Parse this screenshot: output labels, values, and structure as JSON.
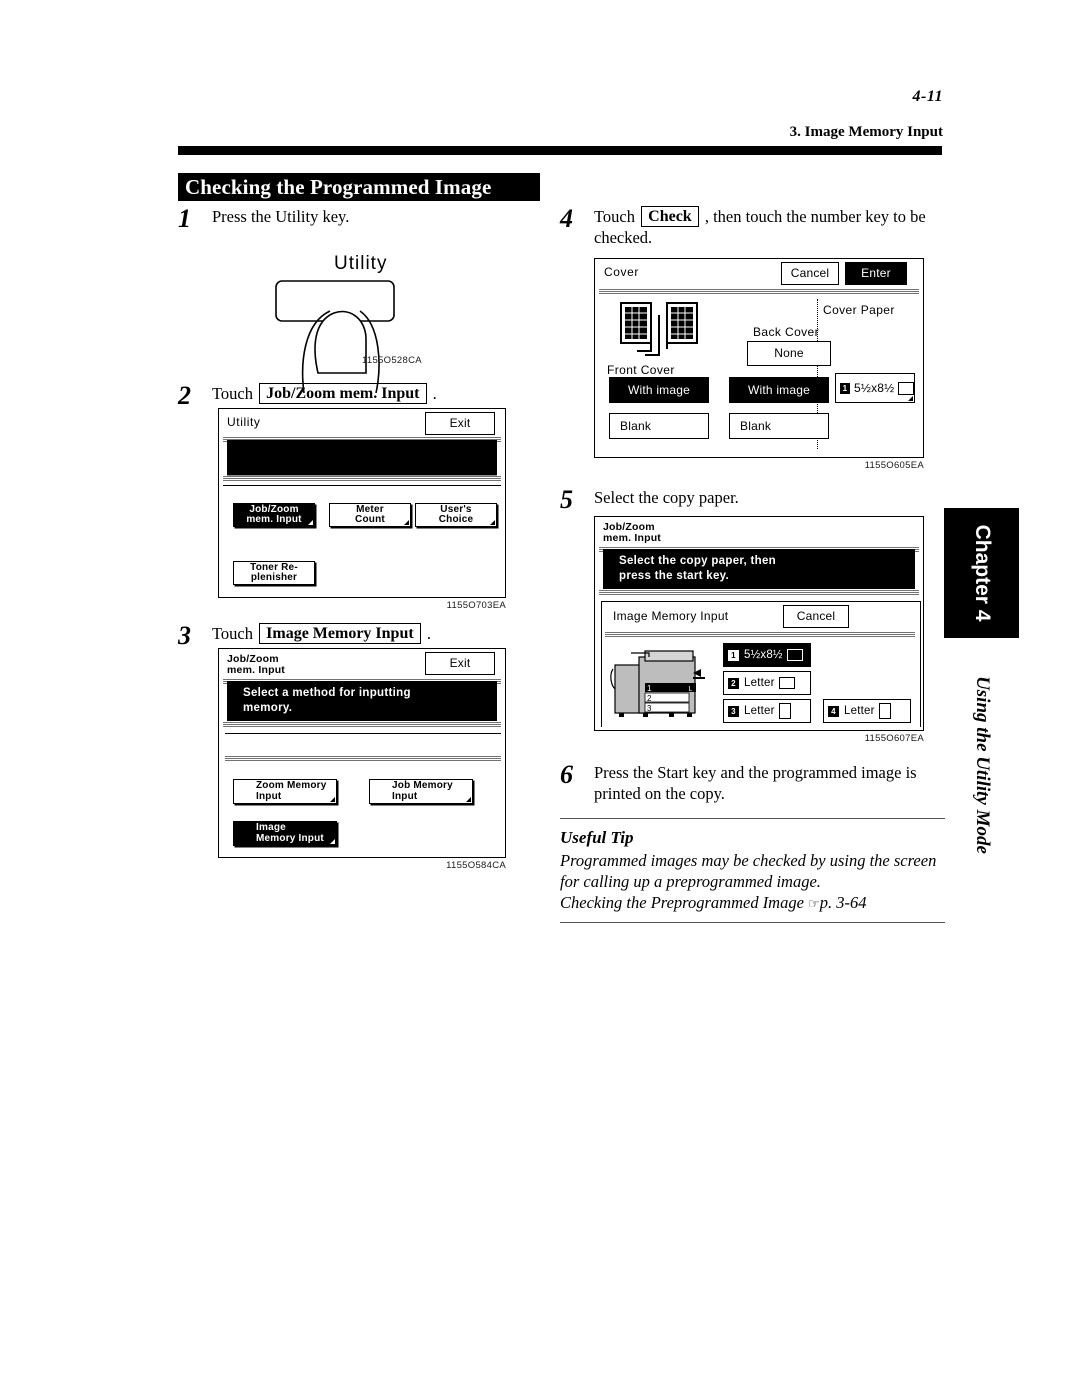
{
  "page": {
    "number": "4-11",
    "running_head": "3. Image Memory Input",
    "section_title": "Checking the Programmed Image"
  },
  "chapter_tab": {
    "label": "Chapter 4",
    "subtitle": "Using the Utility Mode"
  },
  "steps": {
    "s1": {
      "num": "1",
      "text": "Press the Utility key."
    },
    "s2": {
      "num": "2",
      "pre": "Touch",
      "key": "Job/Zoom mem. Input",
      "post": "."
    },
    "s3": {
      "num": "3",
      "pre": "Touch",
      "key": "Image Memory Input",
      "post": "."
    },
    "s4": {
      "num": "4",
      "pre": "Touch",
      "key": "Check",
      "post": ", then touch the number key to be checked."
    },
    "s5": {
      "num": "5",
      "text": "Select the copy paper."
    },
    "s6": {
      "num": "6",
      "text": "Press the Start key and the programmed image is printed on the copy."
    }
  },
  "fig1": {
    "label": "Utility",
    "id": "1155O528CA"
  },
  "fig2": {
    "id": "1155O703EA",
    "title": "Utility",
    "exit": "Exit",
    "buttons": [
      {
        "label": "Job/Zoom\nmem. Input",
        "selected": true
      },
      {
        "label": "Meter\nCount",
        "selected": false
      },
      {
        "label": "User's\nChoice",
        "selected": false
      },
      {
        "label": "Toner Re-\nplenisher",
        "selected": false
      }
    ]
  },
  "fig3": {
    "id": "1155O584CA",
    "title": "Job/Zoom\nmem. Input",
    "exit": "Exit",
    "message": "Select a method for inputting\nmemory.",
    "buttons": [
      {
        "label": "Zoom Memory\nInput",
        "selected": false
      },
      {
        "label": "Job Memory\nInput",
        "selected": false
      },
      {
        "label": "Image\nMemory Input",
        "selected": true
      }
    ]
  },
  "fig4": {
    "id": "1155O605EA",
    "title": "Cover",
    "cancel": "Cancel",
    "enter": "Enter",
    "cover_paper_label": "Cover Paper",
    "front_cover_label": "Front Cover",
    "back_cover_label": "Back Cover",
    "front_buttons": [
      {
        "label": "With image",
        "selected": true
      },
      {
        "label": "Blank",
        "selected": false
      }
    ],
    "back_buttons": [
      {
        "label": "None",
        "selected": false
      },
      {
        "label": "With image",
        "selected": true
      },
      {
        "label": "Blank",
        "selected": false
      }
    ],
    "paper": {
      "num": "1",
      "label": "5½x8½"
    }
  },
  "fig5": {
    "id": "1155O607EA",
    "title": "Job/Zoom\nmem. Input",
    "message": "Select the copy paper, then\npress the start key.",
    "sub_title": "Image Memory Input",
    "cancel": "Cancel",
    "trays": [
      {
        "num": "1",
        "label": "5½x8½",
        "orient": "landscape",
        "selected": true
      },
      {
        "num": "2",
        "label": "Letter",
        "orient": "landscape",
        "selected": false
      },
      {
        "num": "3",
        "label": "Letter",
        "orient": "portrait",
        "selected": false
      },
      {
        "num": "4",
        "label": "Letter",
        "orient": "portrait",
        "selected": false
      }
    ],
    "copier_trays": [
      "1",
      "2",
      "3"
    ],
    "bypass_label": "L"
  },
  "tip": {
    "heading": "Useful Tip",
    "body": "Programmed images may be checked by using the screen for calling up a preprogrammed image.",
    "reference": "Checking the Preprogrammed Image",
    "reference_page": "p. 3-64"
  }
}
